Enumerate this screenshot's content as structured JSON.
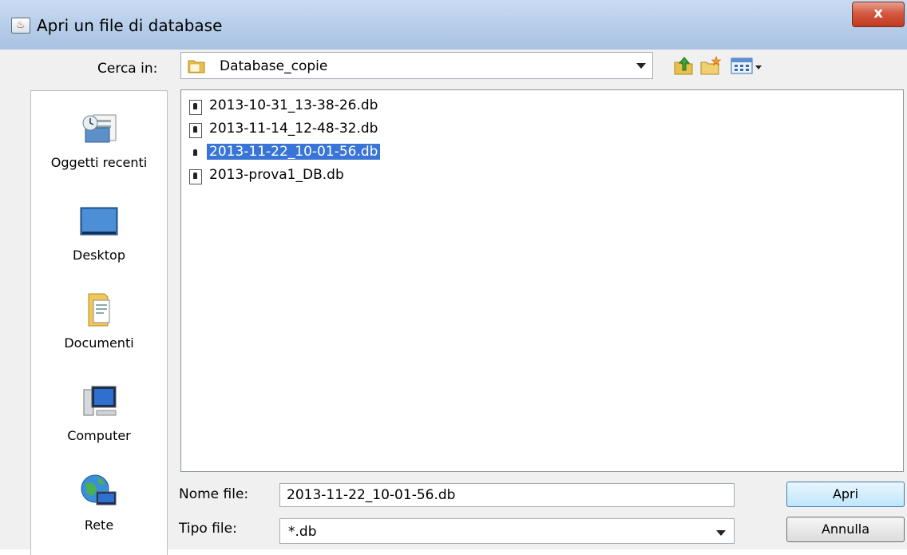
{
  "window": {
    "title": "Apri un file di database",
    "close_glyph": "x"
  },
  "lookin": {
    "label": "Cerca in:",
    "value": "Database_copie"
  },
  "sidebar": {
    "items": [
      {
        "label": "Oggetti recenti",
        "icon": "recent-items-icon"
      },
      {
        "label": "Desktop",
        "icon": "desktop-icon"
      },
      {
        "label": "Documenti",
        "icon": "documents-icon"
      },
      {
        "label": "Computer",
        "icon": "computer-icon"
      },
      {
        "label": "Rete",
        "icon": "network-icon"
      }
    ]
  },
  "files": [
    {
      "name": "2013-10-31_13-38-26.db",
      "selected": false
    },
    {
      "name": "2013-11-14_12-48-32.db",
      "selected": false
    },
    {
      "name": "2013-11-22_10-01-56.db",
      "selected": true
    },
    {
      "name": "2013-prova1_DB.db",
      "selected": false
    }
  ],
  "filename": {
    "label": "Nome file:",
    "value": "2013-11-22_10-01-56.db"
  },
  "filetype": {
    "label": "Tipo file:",
    "value": "*.db"
  },
  "buttons": {
    "open": "Apri",
    "cancel": "Annulla"
  },
  "colors": {
    "selection": "#3875d6",
    "titlebar": "#b6cde9",
    "close": "#c33a22"
  }
}
